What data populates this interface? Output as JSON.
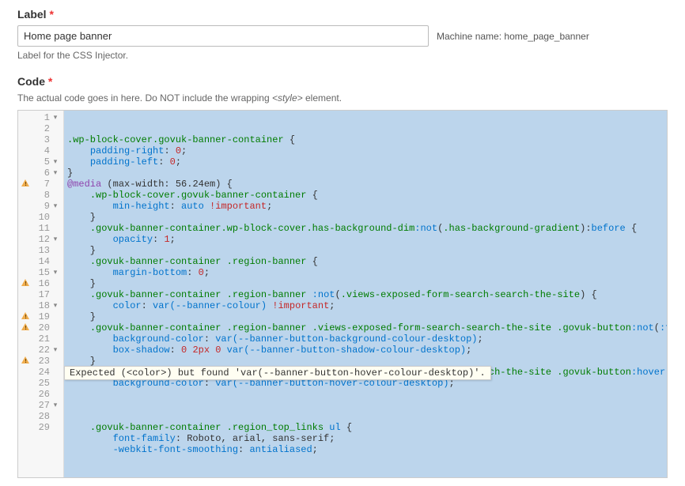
{
  "label_field": {
    "label": "Label",
    "required": "*",
    "value": "Home page banner",
    "machine_name_label": "Machine name:",
    "machine_name_value": "home_page_banner",
    "help": "Label for the CSS Injector."
  },
  "code_field": {
    "label": "Code",
    "required": "*",
    "help_prefix": "The actual code goes in here. Do NOT include the wrapping ",
    "help_tag": "<style>",
    "help_suffix": " element.",
    "tooltip": "Expected (<color>) but found 'var(--banner-button-hover-colour-desktop)'.",
    "lines": [
      {
        "n": 1,
        "fold": true,
        "warn": false,
        "tokens": [
          [
            "sel",
            ".wp-block-cover.govuk-banner-container"
          ],
          [
            "text",
            " {"
          ]
        ]
      },
      {
        "n": 2,
        "fold": false,
        "warn": false,
        "tokens": [
          [
            "text",
            "    "
          ],
          [
            "prop",
            "padding-right"
          ],
          [
            "text",
            ": "
          ],
          [
            "num",
            "0"
          ],
          [
            "text",
            ";"
          ]
        ]
      },
      {
        "n": 3,
        "fold": false,
        "warn": false,
        "tokens": [
          [
            "text",
            "    "
          ],
          [
            "prop",
            "padding-left"
          ],
          [
            "text",
            ": "
          ],
          [
            "num",
            "0"
          ],
          [
            "text",
            ";"
          ]
        ]
      },
      {
        "n": 4,
        "fold": false,
        "warn": false,
        "tokens": [
          [
            "text",
            "}"
          ]
        ]
      },
      {
        "n": 5,
        "fold": true,
        "warn": false,
        "tokens": [
          [
            "at",
            "@media"
          ],
          [
            "text",
            " (max-width: 56.24em) {"
          ]
        ]
      },
      {
        "n": 6,
        "fold": true,
        "warn": false,
        "tokens": [
          [
            "text",
            "    "
          ],
          [
            "sel",
            ".wp-block-cover.govuk-banner-container"
          ],
          [
            "text",
            " {"
          ]
        ]
      },
      {
        "n": 7,
        "fold": false,
        "warn": true,
        "tokens": [
          [
            "text",
            "        "
          ],
          [
            "prop",
            "min-height"
          ],
          [
            "text",
            ": "
          ],
          [
            "kw",
            "auto"
          ],
          [
            "text",
            " "
          ],
          [
            "imp",
            "!important"
          ],
          [
            "text",
            ";"
          ]
        ]
      },
      {
        "n": 8,
        "fold": false,
        "warn": false,
        "tokens": [
          [
            "text",
            "    }"
          ]
        ]
      },
      {
        "n": 9,
        "fold": true,
        "warn": false,
        "tokens": [
          [
            "text",
            "    "
          ],
          [
            "sel",
            ".govuk-banner-container.wp-block-cover.has-background-dim"
          ],
          [
            "psel",
            ":not"
          ],
          [
            "text",
            "("
          ],
          [
            "sel",
            ".has-background-gradient"
          ],
          [
            "text",
            "):"
          ],
          [
            "psel",
            "before"
          ],
          [
            "text",
            " {"
          ]
        ]
      },
      {
        "n": 10,
        "fold": false,
        "warn": false,
        "tokens": [
          [
            "text",
            "        "
          ],
          [
            "prop",
            "opacity"
          ],
          [
            "text",
            ": "
          ],
          [
            "num",
            "1"
          ],
          [
            "text",
            ";"
          ]
        ]
      },
      {
        "n": 11,
        "fold": false,
        "warn": false,
        "tokens": [
          [
            "text",
            "    }"
          ]
        ]
      },
      {
        "n": 12,
        "fold": true,
        "warn": false,
        "tokens": [
          [
            "text",
            "    "
          ],
          [
            "sel",
            ".govuk-banner-container .region-banner"
          ],
          [
            "text",
            " {"
          ]
        ]
      },
      {
        "n": 13,
        "fold": false,
        "warn": false,
        "tokens": [
          [
            "text",
            "        "
          ],
          [
            "prop",
            "margin-bottom"
          ],
          [
            "text",
            ": "
          ],
          [
            "num",
            "0"
          ],
          [
            "text",
            ";"
          ]
        ]
      },
      {
        "n": 14,
        "fold": false,
        "warn": false,
        "tokens": [
          [
            "text",
            "    }"
          ]
        ]
      },
      {
        "n": 15,
        "fold": true,
        "warn": false,
        "tokens": [
          [
            "text",
            "    "
          ],
          [
            "sel",
            ".govuk-banner-container .region-banner "
          ],
          [
            "psel",
            ":not"
          ],
          [
            "text",
            "("
          ],
          [
            "sel",
            ".views-exposed-form-search-search-the-site"
          ],
          [
            "text",
            ") {"
          ]
        ]
      },
      {
        "n": 16,
        "fold": false,
        "warn": true,
        "tokens": [
          [
            "text",
            "        "
          ],
          [
            "prop",
            "color"
          ],
          [
            "text",
            ": "
          ],
          [
            "kw",
            "var(--banner-colour)"
          ],
          [
            "text",
            " "
          ],
          [
            "imp",
            "!important"
          ],
          [
            "text",
            ";"
          ]
        ]
      },
      {
        "n": 17,
        "fold": false,
        "warn": false,
        "tokens": [
          [
            "text",
            "    }"
          ]
        ]
      },
      {
        "n": 18,
        "fold": true,
        "warn": false,
        "tokens": [
          [
            "text",
            "    "
          ],
          [
            "sel",
            ".govuk-banner-container .region-banner .views-exposed-form-search-search-the-site .govuk-button"
          ],
          [
            "psel",
            ":not"
          ],
          [
            "text",
            "("
          ],
          [
            "psel",
            ":focus"
          ],
          [
            "text",
            ") {"
          ]
        ]
      },
      {
        "n": 19,
        "fold": false,
        "warn": true,
        "tokens": [
          [
            "text",
            "        "
          ],
          [
            "prop",
            "background-color"
          ],
          [
            "text",
            ": "
          ],
          [
            "kw",
            "var(--banner-button-background-colour-desktop)"
          ],
          [
            "text",
            ";"
          ]
        ]
      },
      {
        "n": 20,
        "fold": false,
        "warn": true,
        "tokens": [
          [
            "text",
            "        "
          ],
          [
            "prop",
            "box-shadow"
          ],
          [
            "text",
            ": "
          ],
          [
            "num",
            "0"
          ],
          [
            "text",
            " "
          ],
          [
            "num",
            "2px"
          ],
          [
            "text",
            " "
          ],
          [
            "num",
            "0"
          ],
          [
            "text",
            " "
          ],
          [
            "kw",
            "var(--banner-button-shadow-colour-desktop)"
          ],
          [
            "text",
            ";"
          ]
        ]
      },
      {
        "n": 21,
        "fold": false,
        "warn": false,
        "tokens": [
          [
            "text",
            "    }"
          ]
        ]
      },
      {
        "n": 22,
        "fold": true,
        "warn": false,
        "tokens": [
          [
            "text",
            "    "
          ],
          [
            "sel",
            ".govuk-banner-container .region-banner .views-exposed-form-search-search-the-site .govuk-button"
          ],
          [
            "psel",
            ":hover"
          ],
          [
            "text",
            " {"
          ]
        ]
      },
      {
        "n": 23,
        "fold": false,
        "warn": true,
        "tokens": [
          [
            "text",
            "        "
          ],
          [
            "prop",
            "background-color"
          ],
          [
            "text",
            ": "
          ],
          [
            "kw",
            "var(--banner-button-hover-colour-desktop)"
          ],
          [
            "text",
            ";"
          ]
        ]
      },
      {
        "n": 24,
        "fold": false,
        "warn": false,
        "tokens": []
      },
      {
        "n": 25,
        "fold": false,
        "warn": false,
        "tokens": []
      },
      {
        "n": 26,
        "fold": false,
        "warn": false,
        "tokens": [
          [
            "text",
            ""
          ]
        ]
      },
      {
        "n": 27,
        "fold": true,
        "warn": false,
        "tokens": [
          [
            "text",
            "    "
          ],
          [
            "sel",
            ".govuk-banner-container .region_top_links "
          ],
          [
            "psel",
            "ul"
          ],
          [
            "text",
            " {"
          ]
        ]
      },
      {
        "n": 28,
        "fold": false,
        "warn": false,
        "tokens": [
          [
            "text",
            "        "
          ],
          [
            "prop",
            "font-family"
          ],
          [
            "text",
            ": Roboto, arial, sans-serif;"
          ]
        ]
      },
      {
        "n": 29,
        "fold": false,
        "warn": false,
        "tokens": [
          [
            "text",
            "        "
          ],
          [
            "prop",
            "-webkit-font-smoothing"
          ],
          [
            "text",
            ": "
          ],
          [
            "kw",
            "antialiased"
          ],
          [
            "text",
            ";"
          ]
        ]
      }
    ]
  }
}
